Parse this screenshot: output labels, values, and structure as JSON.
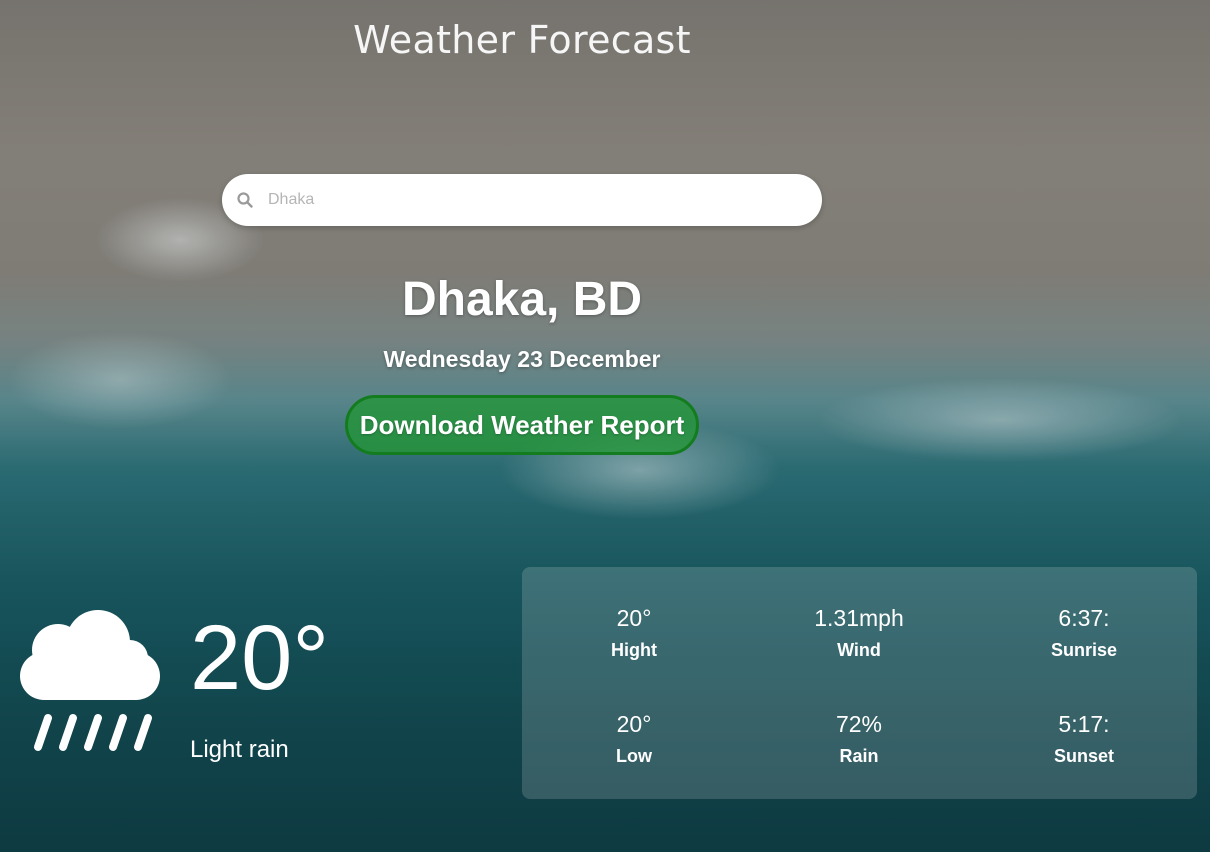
{
  "header": {
    "title": "Weather Forecast"
  },
  "search": {
    "placeholder": "Dhaka",
    "value": ""
  },
  "location": {
    "city": "Dhaka, BD",
    "date": "Wednesday 23 December"
  },
  "actions": {
    "download_label": "Download Weather Report"
  },
  "current": {
    "temperature": "20°",
    "condition": "Light rain",
    "icon": "cloud-rain-icon"
  },
  "stats": [
    {
      "value": "20°",
      "label": "Hight"
    },
    {
      "value": "1.31mph",
      "label": "Wind"
    },
    {
      "value": "6:37:",
      "label": "Sunrise"
    },
    {
      "value": "20°",
      "label": "Low"
    },
    {
      "value": "72%",
      "label": "Rain"
    },
    {
      "value": "5:17:",
      "label": "Sunset"
    }
  ],
  "colors": {
    "button_bg": "#299a3a",
    "button_border": "#137c1f",
    "panel": "rgba(255,255,255,0.16)"
  }
}
